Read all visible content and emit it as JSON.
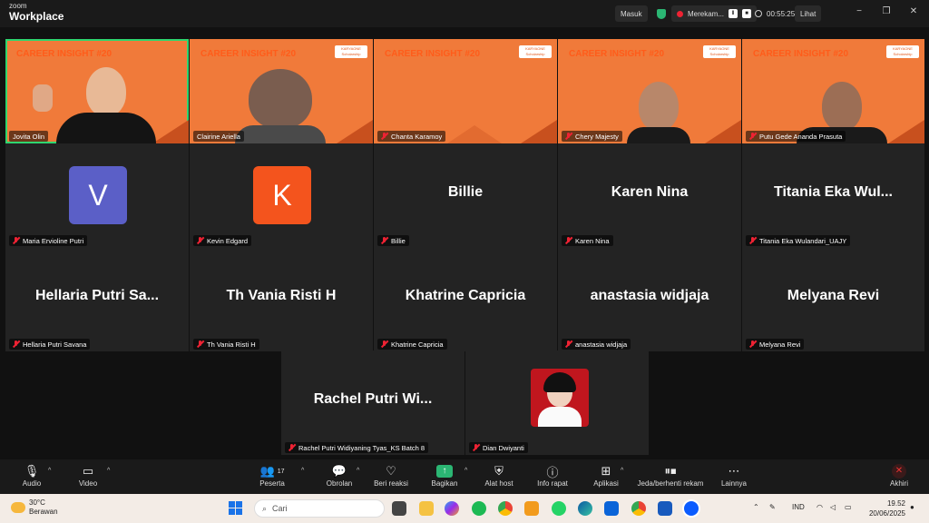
{
  "app": {
    "brand_top": "zoom",
    "brand_bottom": "Workplace"
  },
  "titlebar": {
    "masuk": "Masuk",
    "recording_label": "Merekam...",
    "timer": "00:55:25",
    "view": "Lihat",
    "window_controls": [
      "−",
      "❐",
      "✕"
    ]
  },
  "video_banner": "CAREER INSIGHT #20",
  "logo_text": "KARYAONE Scholarship",
  "tiles": [
    {
      "name": "Jovita Olin"
    },
    {
      "name": "Clairine Ariella"
    },
    {
      "name": "Chanta Karamoy"
    },
    {
      "name": "Chery Majesty"
    },
    {
      "name": "Putu Gede Ananda Prasuta"
    },
    {
      "name": "Maria Ervioline Putri",
      "initial": "V",
      "color": "#5b5fc7"
    },
    {
      "name": "Kevin Edgard",
      "initial": "K",
      "color": "#f4541d"
    },
    {
      "name": "Billie",
      "display": "Billie"
    },
    {
      "name": "Karen Nina",
      "display": "Karen Nina"
    },
    {
      "name": "Titania Eka Wulandari_UAJY",
      "display": "Titania Eka Wul..."
    },
    {
      "name": "Hellaria Putri Savana",
      "display": "Hellaria Putri Sa..."
    },
    {
      "name": "Th Vania Risti H",
      "display": "Th Vania Risti H"
    },
    {
      "name": "Khatrine Capricia",
      "display": "Khatrine Capricia"
    },
    {
      "name": "anastasia widjaja",
      "display": "anastasia widjaja"
    },
    {
      "name": "Melyana Revi",
      "display": "Melyana Revi"
    },
    {
      "name": "Rachel Putri Widiyaning Tyas_KS Batch 8",
      "display": "Rachel Putri Wi..."
    },
    {
      "name": "Dian Dwiyanti"
    }
  ],
  "toolbar": {
    "audio": "Audio",
    "video": "Video",
    "participants": "Peserta",
    "participants_count": "17",
    "chat": "Obrolan",
    "react": "Beri reaksi",
    "share": "Bagikan",
    "host_tools": "Alat host",
    "meeting_info": "Info rapat",
    "apps": "Aplikasi",
    "pause_record": "Jeda/berhenti rekam",
    "more": "Lainnya",
    "end": "Akhiri"
  },
  "taskbar": {
    "temp": "30°C",
    "weather": "Berawan",
    "search": "Cari",
    "lang": "IND",
    "time": "19.52",
    "date": "20/06/2025"
  }
}
